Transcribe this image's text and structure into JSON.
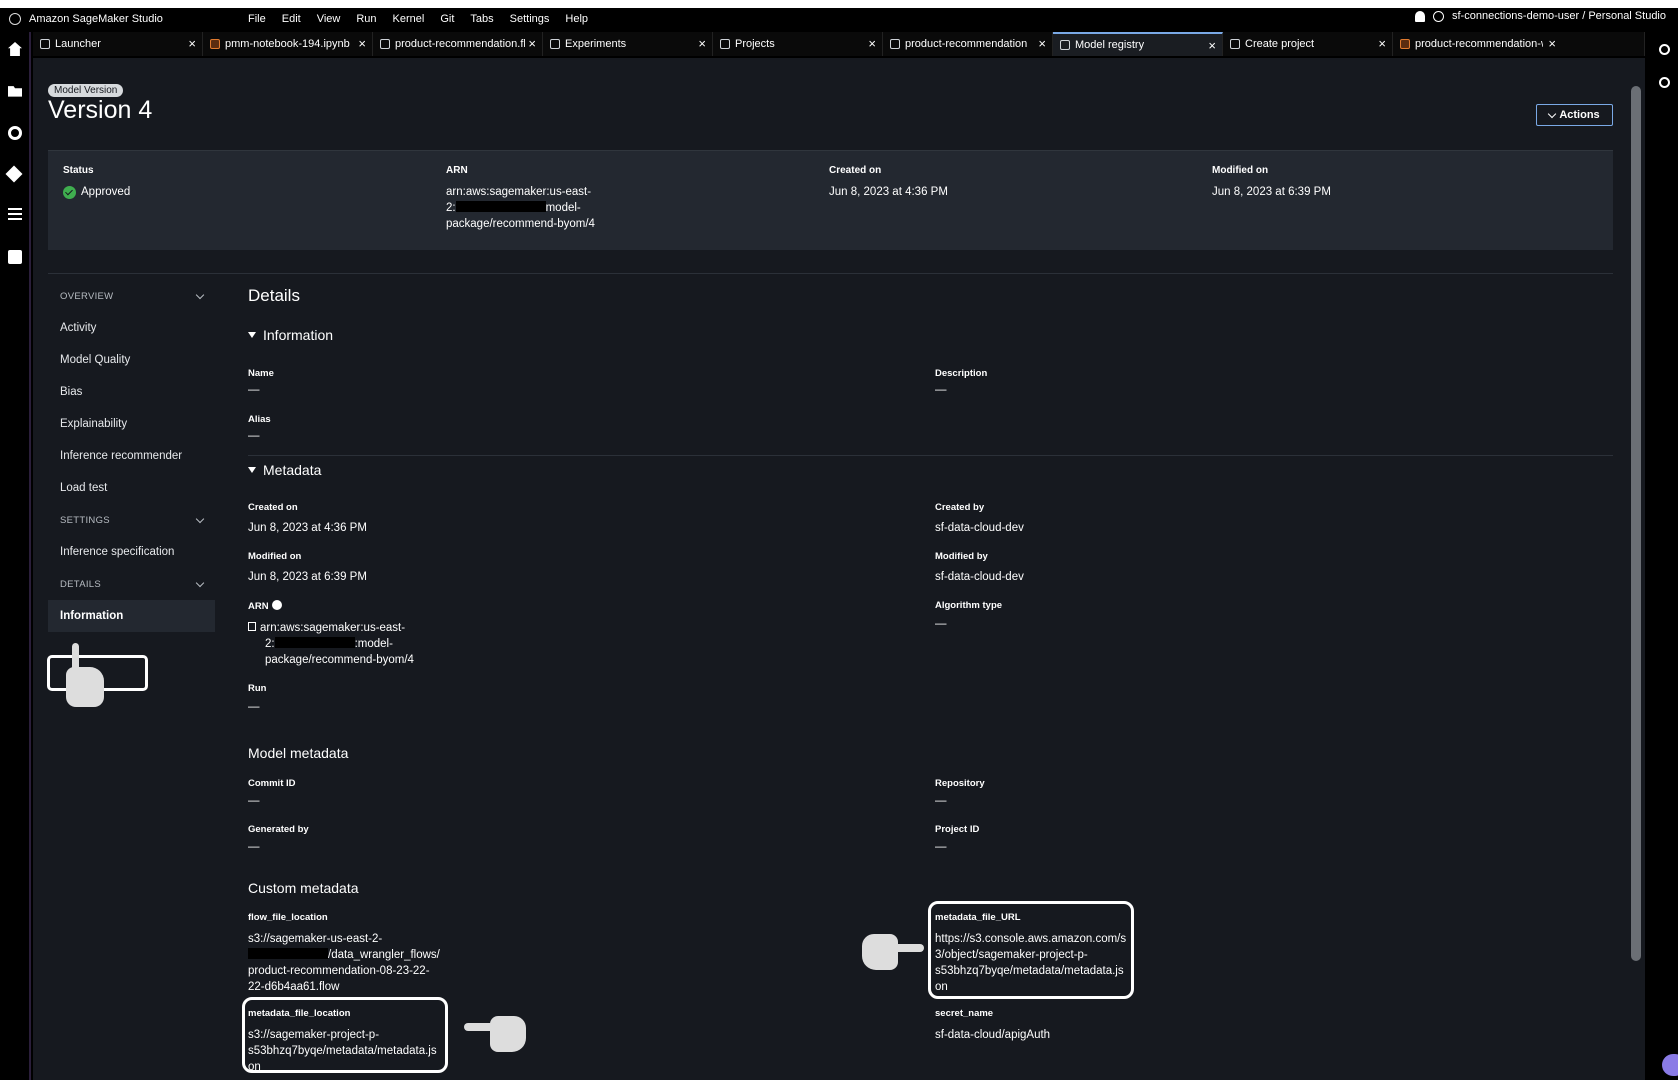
{
  "app": {
    "name": "Amazon SageMaker Studio"
  },
  "menu": [
    "File",
    "Edit",
    "View",
    "Run",
    "Kernel",
    "Git",
    "Tabs",
    "Settings",
    "Help"
  ],
  "user": {
    "label": "sf-connections-demo-user / Personal Studio"
  },
  "tabs": [
    {
      "label": "Launcher",
      "icon": "launcher-icon"
    },
    {
      "label": "pmm-notebook-194.ipynb",
      "icon": "notebook-icon"
    },
    {
      "label": "product-recommendation.flow",
      "icon": "flow-icon"
    },
    {
      "label": "Experiments",
      "icon": "flask-icon"
    },
    {
      "label": "Projects",
      "icon": "share-icon"
    },
    {
      "label": "product-recommendation",
      "icon": "model-icon"
    },
    {
      "label": "Model registry",
      "icon": "registry-icon",
      "active": true
    },
    {
      "label": "Create project",
      "icon": "document-icon"
    },
    {
      "label": "product-recommendation-workflow",
      "icon": "notebook-icon"
    }
  ],
  "header": {
    "badge": "Model Version",
    "title": "Version 4",
    "actions_label": "Actions"
  },
  "summary": {
    "status_label": "Status",
    "status_value": "Approved",
    "arn_label": "ARN",
    "arn_line1": "arn:aws:sagemaker:us-east-",
    "arn_line2_prefix": "2:",
    "arn_line2_suffix": "model-",
    "arn_line3": "package/recommend-byom/4",
    "created_label": "Created on",
    "created_value": "Jun 8, 2023 at 4:36 PM",
    "modified_label": "Modified on",
    "modified_value": "Jun 8, 2023 at 6:39 PM"
  },
  "sidenav": {
    "overview": "OVERVIEW",
    "activity": "Activity",
    "model_quality": "Model Quality",
    "bias": "Bias",
    "explainability": "Explainability",
    "inference_recommender": "Inference recommender",
    "load_test": "Load test",
    "settings": "SETTINGS",
    "inference_spec": "Inference specification",
    "details": "DETAILS",
    "information": "Information"
  },
  "details": {
    "title": "Details",
    "information_title": "Information",
    "name_label": "Name",
    "name_value": "—",
    "description_label": "Description",
    "description_value": "—",
    "alias_label": "Alias",
    "alias_value": "—",
    "metadata_title": "Metadata",
    "created_on_label": "Created on",
    "created_on_value": "Jun 8, 2023 at 4:36 PM",
    "created_by_label": "Created by",
    "created_by_value": "sf-data-cloud-dev",
    "modified_on_label": "Modified on",
    "modified_on_value": "Jun 8, 2023 at 6:39 PM",
    "modified_by_label": "Modified by",
    "modified_by_value": "sf-data-cloud-dev",
    "arn_label": "ARN",
    "arn_line1": "arn:aws:sagemaker:us-east-",
    "arn_line2_prefix": "2:",
    "arn_line2_suffix": ":model-",
    "arn_line3": "package/recommend-byom/4",
    "algorithm_label": "Algorithm type",
    "algorithm_value": "—",
    "run_label": "Run",
    "run_value": "—",
    "model_metadata_title": "Model metadata",
    "commit_label": "Commit ID",
    "commit_value": "—",
    "repository_label": "Repository",
    "repository_value": "—",
    "generated_label": "Generated by",
    "generated_value": "—",
    "project_label": "Project ID",
    "project_value": "—",
    "custom_title": "Custom metadata",
    "flow_label": "flow_file_location",
    "flow_line1": "s3://sagemaker-us-east-2-",
    "flow_line2_suffix": "/data_wrangler_flows/",
    "flow_line3": "product-recommendation-08-23-22-",
    "flow_line4": "22-d6b4aa61.flow",
    "meta_url_label": "metadata_file_URL",
    "meta_url_line1": "https://s3.console.aws.amazon.com/s",
    "meta_url_line2": "3/object/sagemaker-project-p-",
    "meta_url_line3": "s53bhzq7byqe/metadata/metadata.js",
    "meta_url_line4": "on",
    "meta_loc_label": "metadata_file_location",
    "meta_loc_line1": "s3://sagemaker-project-p-",
    "meta_loc_line2": "s53bhzq7byqe/metadata/metadata.js",
    "meta_loc_line3": "on",
    "secret_label": "secret_name",
    "secret_value": "sf-data-cloud/apigAuth"
  }
}
